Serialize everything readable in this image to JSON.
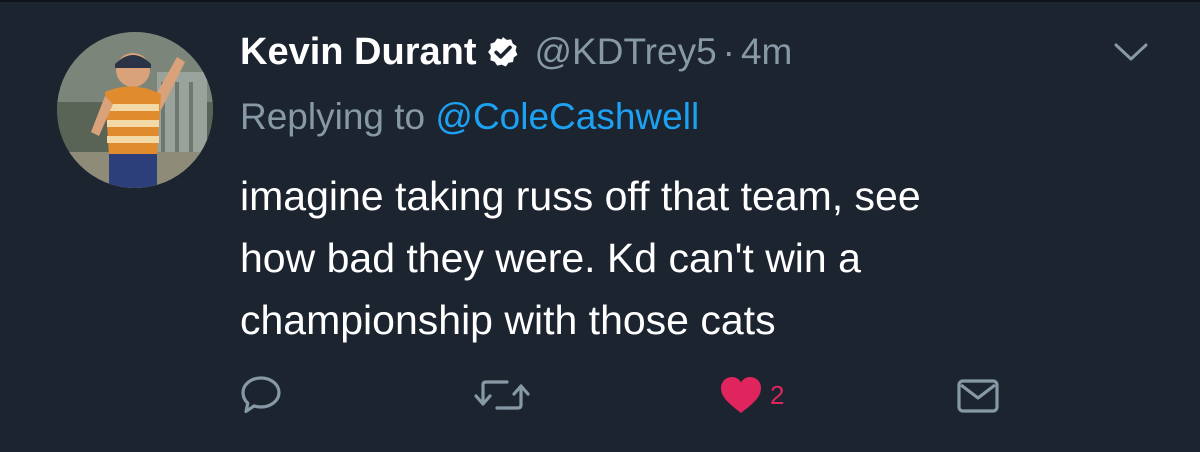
{
  "tweet": {
    "author": {
      "display_name": "Kevin Durant",
      "handle": "@KDTrey5",
      "verified": true,
      "avatar_icon": "profile-photo"
    },
    "separator": "·",
    "timestamp": "4m",
    "reply": {
      "prefix": "Replying to",
      "mention": "@ColeCashwell"
    },
    "text_lines": [
      "imagine taking russ off that team, see",
      "how bad they were. Kd can't win a",
      "championship with those cats"
    ],
    "actions": {
      "reply_icon": "speech-bubble-icon",
      "retweet_icon": "retweet-icon",
      "like_icon": "heart-icon",
      "like_count": "2",
      "dm_icon": "envelope-icon",
      "menu_icon": "chevron-down-icon"
    }
  },
  "colors": {
    "background": "#1c2430",
    "primary_text": "#ffffff",
    "secondary_text": "#8899a6",
    "link": "#1da1f2",
    "like": "#e0245e"
  }
}
